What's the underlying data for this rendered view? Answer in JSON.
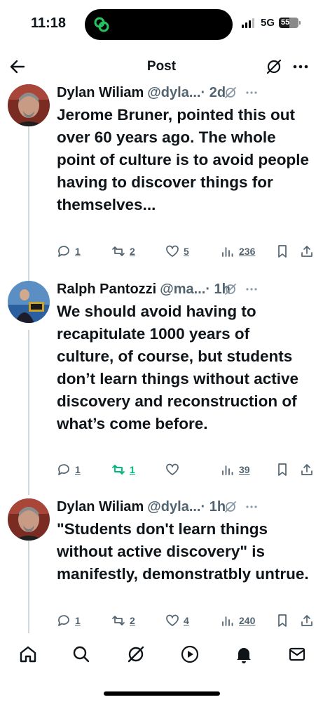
{
  "status_bar": {
    "time": "11:18",
    "network": "5G",
    "battery_label": "55",
    "battery_level": 0.55
  },
  "header": {
    "title": "Post"
  },
  "tweets": [
    {
      "name": "Dylan Wiliam",
      "handle": "@dyla...",
      "time": "· 2d",
      "text": "Jerome Bruner, pointed this out over 60 years ago. The whole point of culture is to avoid people having to discover things for themselves...",
      "replies": "1",
      "reposts": "2",
      "likes": "5",
      "views": "236"
    },
    {
      "name": "Ralph Pantozzi",
      "handle": "@ma...",
      "time": "· 1h",
      "text": "We should avoid having to recapitulate 1000 years of culture, of course, but students don’t learn things without active discovery and reconstruction of what’s come before.",
      "replies": "1",
      "reposts": "1",
      "likes": "",
      "views": "39"
    },
    {
      "name": "Dylan Wiliam",
      "handle": "@dyla...",
      "time": "· 1h",
      "text": "\"Students don't learn things without active discovery\" is manifestly, demonstratbly untrue.",
      "replies": "1",
      "reposts": "2",
      "likes": "4",
      "views": "240"
    }
  ],
  "colors": {
    "text": "#0f1419",
    "secondary": "#536471",
    "repost_active": "#00ba7c",
    "thread_line": "#cfd9de",
    "island_app": "#22c55e"
  },
  "icons": [
    "back-icon",
    "grok-icon",
    "more-icon",
    "reply-icon",
    "repost-icon",
    "like-icon",
    "views-icon",
    "bookmark-icon",
    "share-icon",
    "home-icon",
    "search-icon",
    "play-icon",
    "notifications-icon",
    "messages-icon"
  ]
}
